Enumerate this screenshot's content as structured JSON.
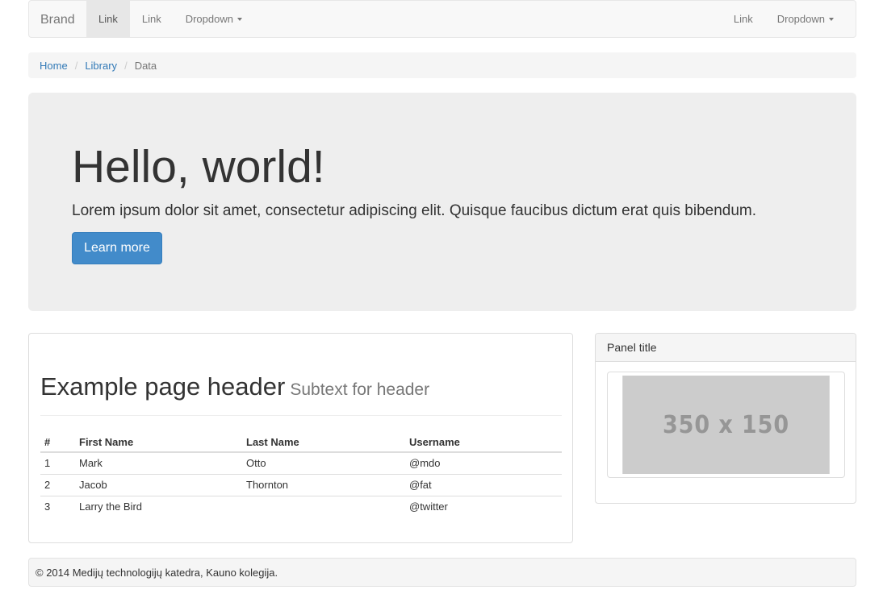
{
  "navbar": {
    "brand": "Brand",
    "left_items": [
      {
        "label": "Link",
        "active": true
      },
      {
        "label": "Link",
        "active": false
      },
      {
        "label": "Dropdown",
        "dropdown": true
      }
    ],
    "right_items": [
      {
        "label": "Link"
      },
      {
        "label": "Dropdown",
        "dropdown": true
      }
    ]
  },
  "breadcrumb": {
    "items": [
      "Home",
      "Library"
    ],
    "active": "Data",
    "separator": "/"
  },
  "jumbotron": {
    "title": "Hello, world!",
    "text": "Lorem ipsum dolor sit amet, consectetur adipiscing elit. Quisque faucibus dictum erat quis bibendum.",
    "button_label": "Learn more"
  },
  "main_panel": {
    "header_title": "Example page header",
    "header_subtext": "Subtext for header",
    "table": {
      "headers": [
        "#",
        "First Name",
        "Last Name",
        "Username"
      ],
      "rows": [
        [
          "1",
          "Mark",
          "Otto",
          "@mdo"
        ],
        [
          "2",
          "Jacob",
          "Thornton",
          "@fat"
        ],
        [
          "3",
          "Larry the Bird",
          "",
          "@twitter"
        ]
      ]
    }
  },
  "side_panel": {
    "title": "Panel title",
    "image_placeholder_text": "350 x 150"
  },
  "footer": {
    "text": "© 2014 Medijų technologijų katedra, Kauno kolegija."
  },
  "colors": {
    "primary": "#428bca",
    "link": "#337ab7",
    "jumbotron_bg": "#eeeeee",
    "navbar_bg": "#f8f8f8"
  }
}
